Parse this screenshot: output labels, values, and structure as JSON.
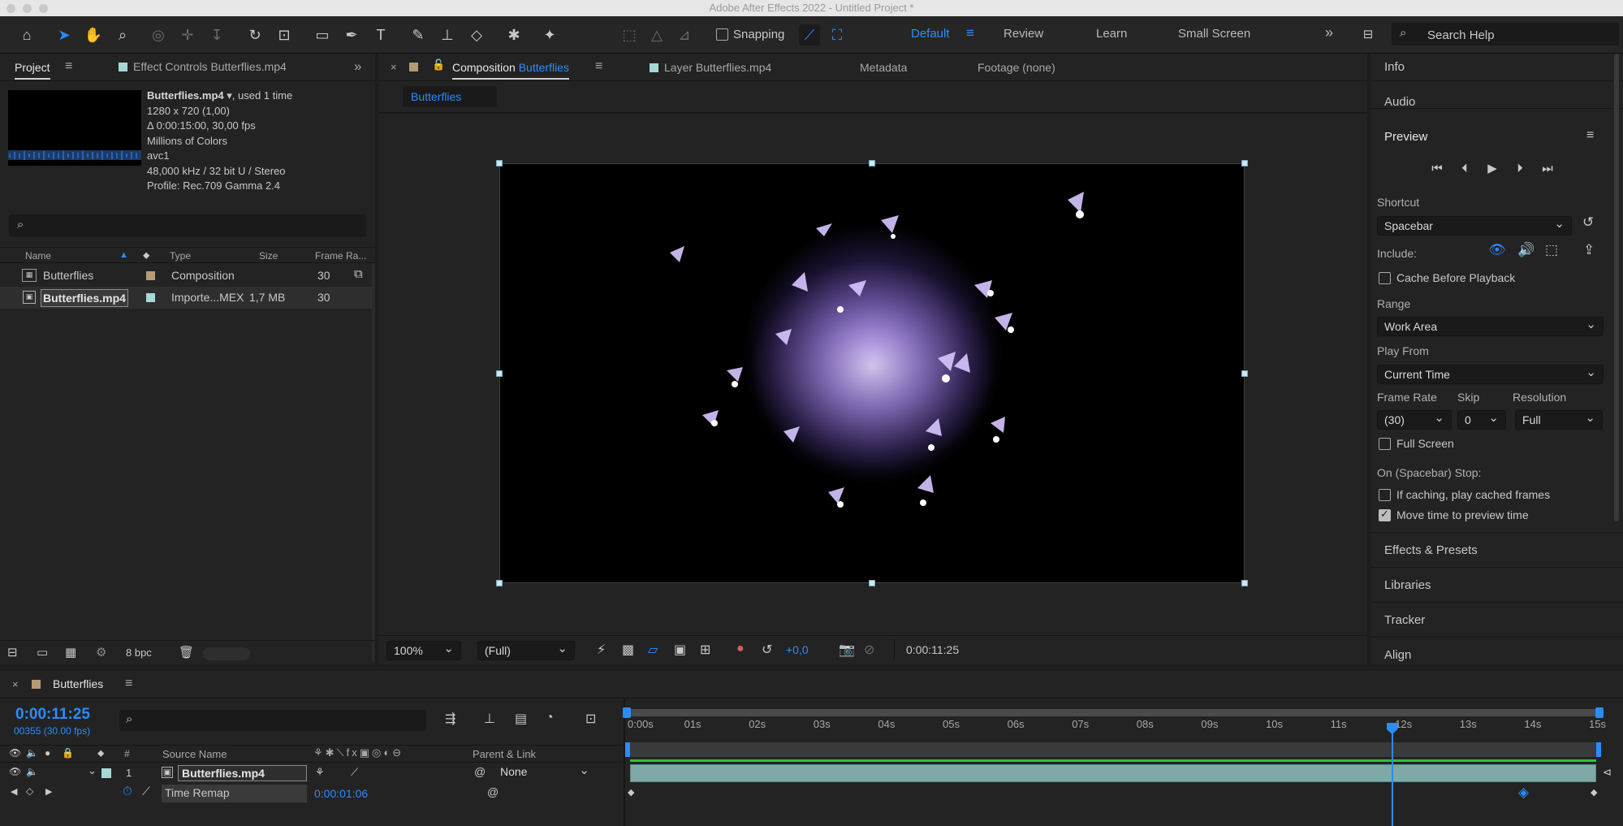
{
  "window": {
    "title": "Adobe After Effects 2022 - Untitled Project *"
  },
  "toolbar": {
    "snapping_label": "Snapping",
    "workspaces": [
      "Default",
      "Review",
      "Learn",
      "Small Screen"
    ],
    "active_workspace": "Default",
    "search_placeholder": "Search Help"
  },
  "project_panel": {
    "tabs": {
      "project": "Project",
      "effect_controls": "Effect Controls Butterflies.mp4"
    },
    "selected_item": {
      "name": "Butterflies.mp4",
      "usage": ", used 1 time",
      "info": [
        "1280 x 720 (1,00)",
        "Δ 0:00:15:00, 30,00 fps",
        "Millions of Colors",
        "avc1",
        "48,000 kHz / 32 bit U / Stereo",
        "Profile: Rec.709 Gamma 2.4"
      ]
    },
    "search_placeholder": "",
    "columns": {
      "name": "Name",
      "type": "Type",
      "size": "Size",
      "frame_rate": "Frame Ra..."
    },
    "items": [
      {
        "name": "Butterflies",
        "type": "Composition",
        "size": "",
        "frame_rate": "30",
        "label_color": "#b59a74"
      },
      {
        "name": "Butterflies.mp4",
        "type": "Importe...MEX",
        "size": "1,7 MB",
        "frame_rate": "30",
        "label_color": "#a6d9d6"
      }
    ],
    "footer": {
      "bpc": "8 bpc"
    }
  },
  "viewer": {
    "tabs": {
      "composition_prefix": "Composition",
      "composition_name": "Butterflies",
      "layer": "Layer Butterflies.mp4",
      "metadata": "Metadata",
      "footage": "Footage (none)"
    },
    "breadcrumb": "Butterflies",
    "zoom": "100%",
    "resolution": "(Full)",
    "exposure": "+0,0",
    "timecode": "0:00:11:25"
  },
  "right_panel": {
    "sections": {
      "info": "Info",
      "audio": "Audio",
      "preview": "Preview"
    },
    "shortcut_label": "Shortcut",
    "shortcut_value": "Spacebar",
    "include_label": "Include:",
    "cache_before_playback": "Cache Before Playback",
    "range_label": "Range",
    "range_value": "Work Area",
    "play_from_label": "Play From",
    "play_from_value": "Current Time",
    "frame_rate_label": "Frame Rate",
    "frame_rate_value": "(30)",
    "skip_label": "Skip",
    "skip_value": "0",
    "resolution_label": "Resolution",
    "resolution_value": "Full",
    "full_screen": "Full Screen",
    "stop_label": "On (Spacebar) Stop:",
    "if_caching": "If caching, play cached frames",
    "move_time": "Move time to preview time",
    "collapsed": [
      "Effects & Presets",
      "Libraries",
      "Tracker",
      "Align"
    ]
  },
  "timeline": {
    "comp_name": "Butterflies",
    "current_time": "0:00:11:25",
    "frame_info": "00355 (30.00 fps)",
    "columns": {
      "number": "#",
      "source_name": "Source Name",
      "parent": "Parent & Link"
    },
    "layer": {
      "index": "1",
      "name": "Butterflies.mp4",
      "parent": "None"
    },
    "property": {
      "name": "Time Remap",
      "value": "0:00:01:06"
    },
    "ruler": [
      "0:00s",
      "01s",
      "02s",
      "03s",
      "04s",
      "05s",
      "06s",
      "07s",
      "08s",
      "09s",
      "10s",
      "11s",
      "12s",
      "13s",
      "14s",
      "15s"
    ],
    "playhead_seconds": 11.83
  }
}
